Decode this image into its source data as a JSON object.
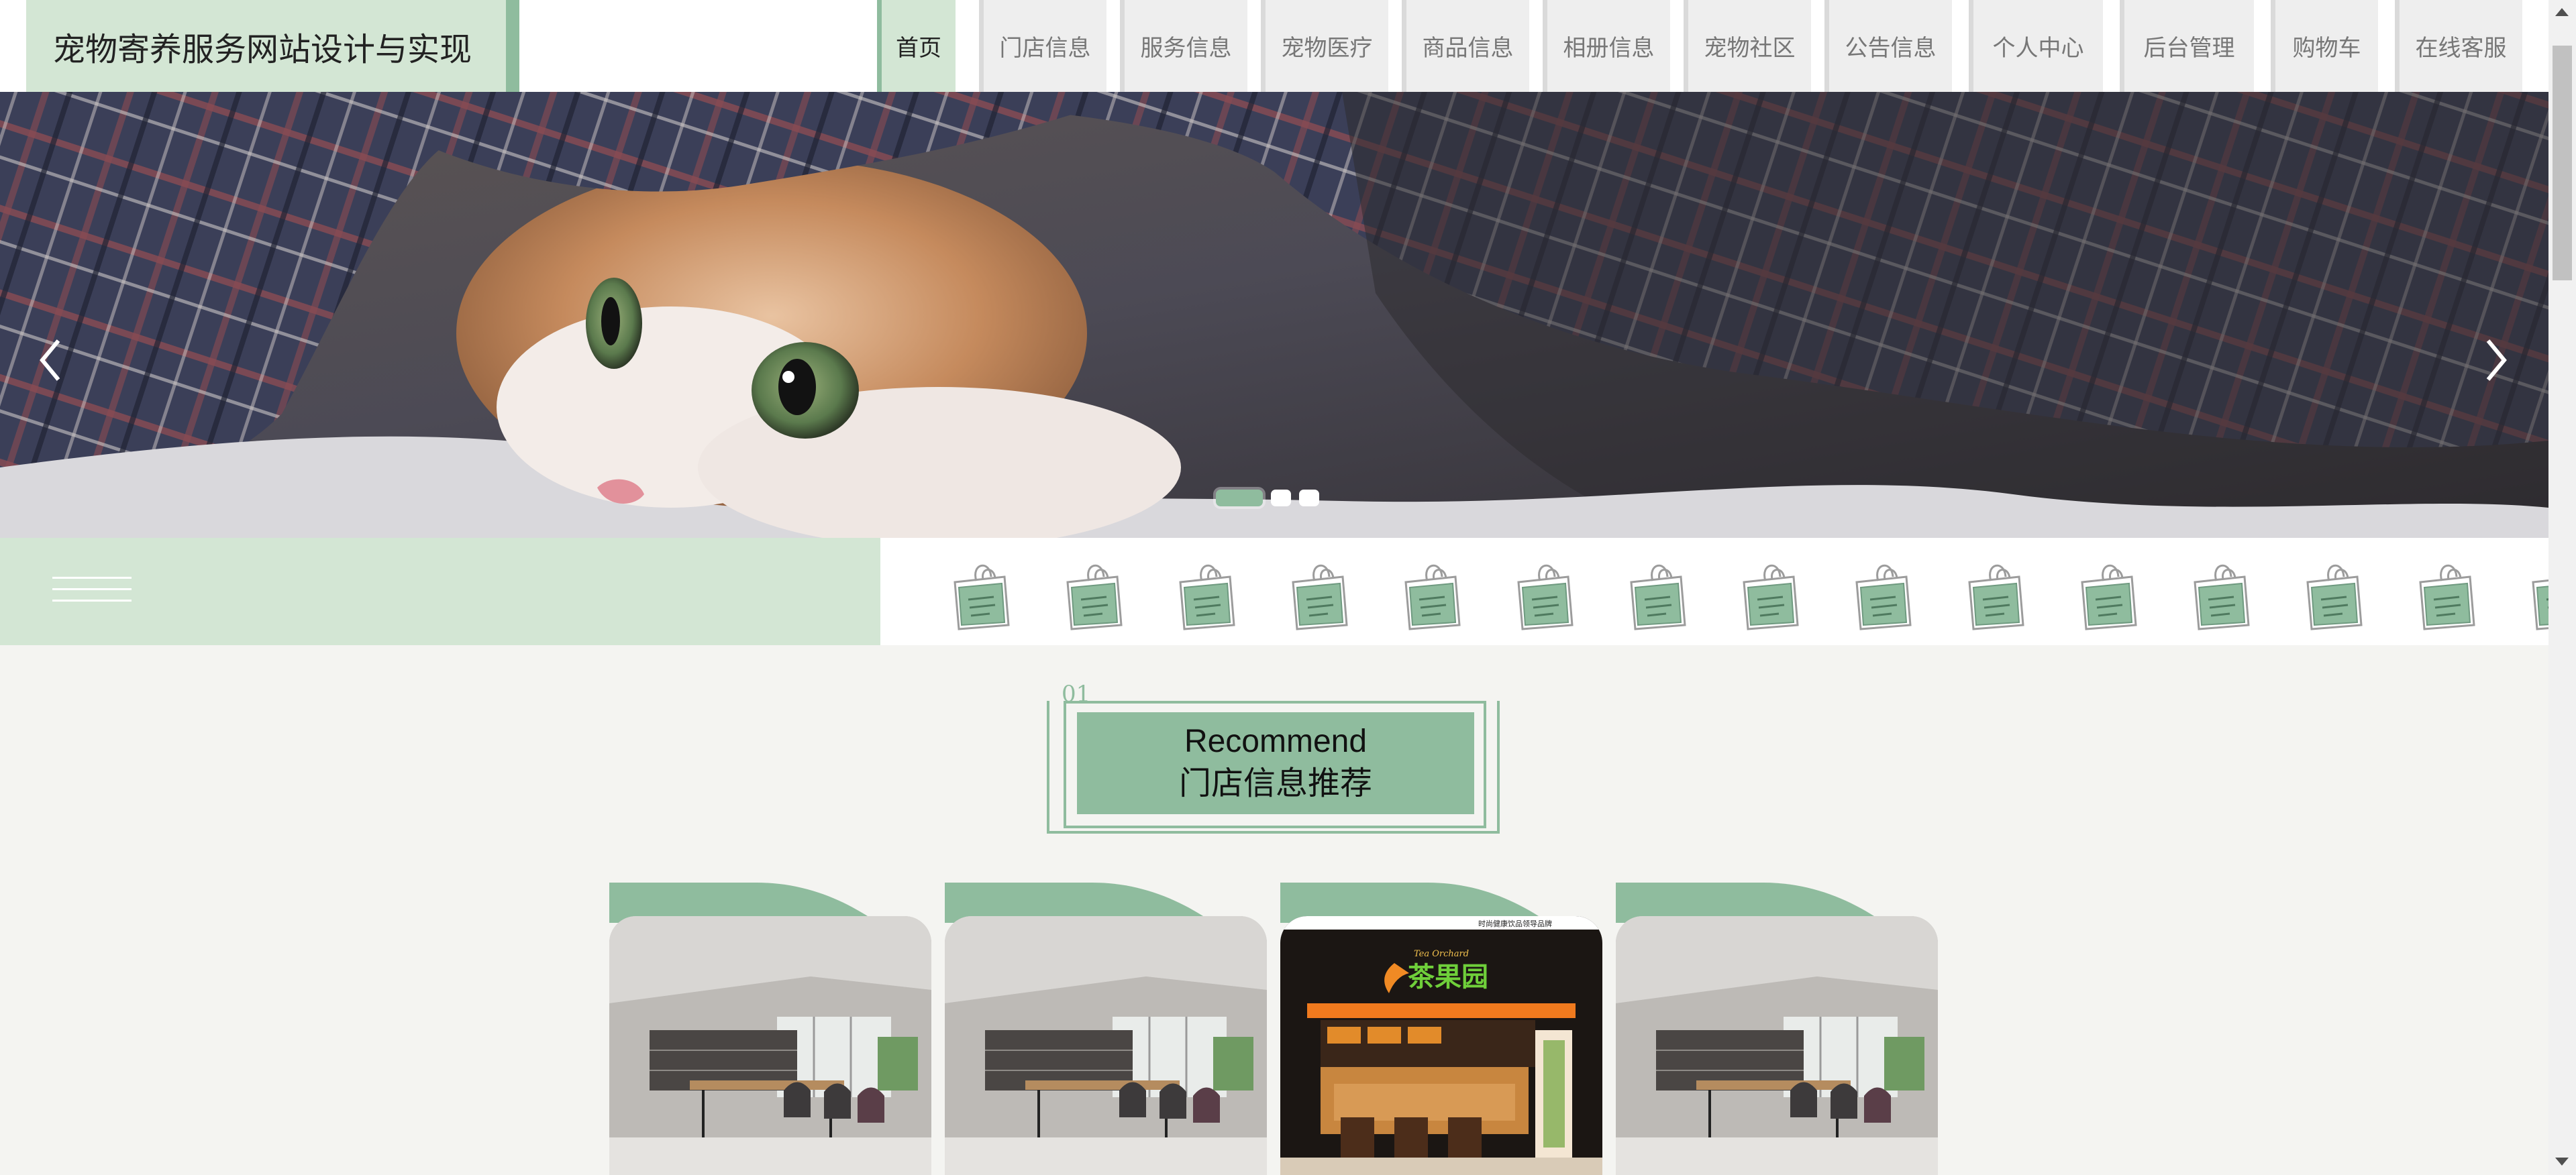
{
  "site": {
    "title": "宠物寄养服务网站设计与实现"
  },
  "nav": [
    {
      "label": "首页",
      "active": true
    },
    {
      "label": "门店信息"
    },
    {
      "label": "服务信息"
    },
    {
      "label": "宠物医疗"
    },
    {
      "label": "商品信息"
    },
    {
      "label": "相册信息"
    },
    {
      "label": "宠物社区"
    },
    {
      "label": "公告信息"
    },
    {
      "label": "个人中心"
    },
    {
      "label": "后台管理"
    },
    {
      "label": "购物车"
    },
    {
      "label": "在线客服"
    }
  ],
  "banner": {
    "slide_count": 3,
    "active_slide": 1
  },
  "section": {
    "number": "01",
    "title_en": "Recommend",
    "title_cn": "门店信息推荐"
  },
  "stores": [
    {
      "image": "store-interior"
    },
    {
      "image": "store-interior"
    },
    {
      "image": "tea-orchard-storefront",
      "sign_cn": "茶果园",
      "sign_en": "Tea Orchard",
      "slogan": "时尚健康饮品领导品牌"
    },
    {
      "image": "store-interior"
    }
  ],
  "colors": {
    "accent": "#8fbc9e",
    "accent_light": "#d3e6d4",
    "background": "#f4f4f1"
  }
}
